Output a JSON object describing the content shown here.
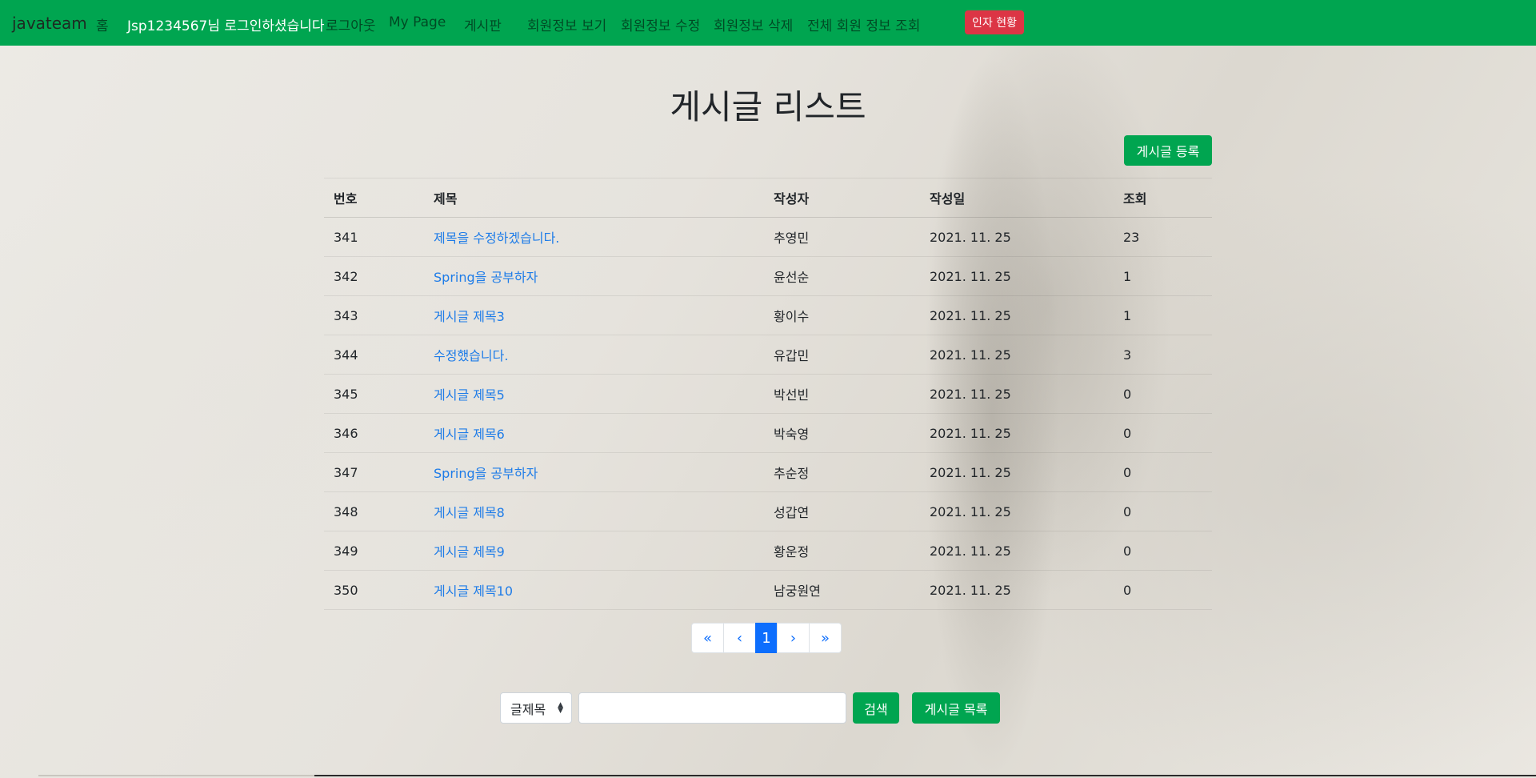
{
  "navbar": {
    "brand": "javateam",
    "items": [
      {
        "label": "홈"
      },
      {
        "label": "Jsp1234567님 로그인하셨습니다"
      },
      {
        "label": "로그아웃"
      },
      {
        "label": "My Page"
      },
      {
        "label": "게시판"
      },
      {
        "label": "회원정보 보기"
      },
      {
        "label": "회원정보 수정"
      },
      {
        "label": "회원정보 삭제"
      },
      {
        "label": "전체 회원 정보 조회"
      }
    ],
    "status_button": "인자 현황",
    "bg_color": "#00a550"
  },
  "page": {
    "title": "게시글 리스트",
    "register_button": "게시글 등록"
  },
  "table": {
    "headers": [
      "번호",
      "제목",
      "작성자",
      "작성일",
      "조회"
    ],
    "rows": [
      {
        "num": "341",
        "title": "제목을 수정하겠습니다.",
        "author": "추영민",
        "date": "2021. 11. 25",
        "views": "23"
      },
      {
        "num": "342",
        "title": "Spring을 공부하자",
        "author": "윤선순",
        "date": "2021. 11. 25",
        "views": "1"
      },
      {
        "num": "343",
        "title": "게시글 제목3",
        "author": "황이수",
        "date": "2021. 11. 25",
        "views": "1"
      },
      {
        "num": "344",
        "title": "수정했습니다.",
        "author": "유갑민",
        "date": "2021. 11. 25",
        "views": "3"
      },
      {
        "num": "345",
        "title": "게시글 제목5",
        "author": "박선빈",
        "date": "2021. 11. 25",
        "views": "0"
      },
      {
        "num": "346",
        "title": "게시글 제목6",
        "author": "박숙영",
        "date": "2021. 11. 25",
        "views": "0"
      },
      {
        "num": "347",
        "title": "Spring을 공부하자",
        "author": "추순정",
        "date": "2021. 11. 25",
        "views": "0"
      },
      {
        "num": "348",
        "title": "게시글 제목8",
        "author": "성갑연",
        "date": "2021. 11. 25",
        "views": "0"
      },
      {
        "num": "349",
        "title": "게시글 제목9",
        "author": "황운정",
        "date": "2021. 11. 25",
        "views": "0"
      },
      {
        "num": "350",
        "title": "게시글 제목10",
        "author": "남궁원연",
        "date": "2021. 11. 25",
        "views": "0"
      }
    ]
  },
  "pagination": {
    "first": "«",
    "prev": "‹",
    "current": "1",
    "next": "›",
    "last": "»"
  },
  "search": {
    "select_value": "글제목",
    "input_value": "",
    "search_button": "검색",
    "list_button": "게시글 목록"
  },
  "colors": {
    "accent": "#00a550",
    "danger": "#dc3545",
    "link": "#1e7ce8",
    "page_active": "#0d6efd"
  }
}
